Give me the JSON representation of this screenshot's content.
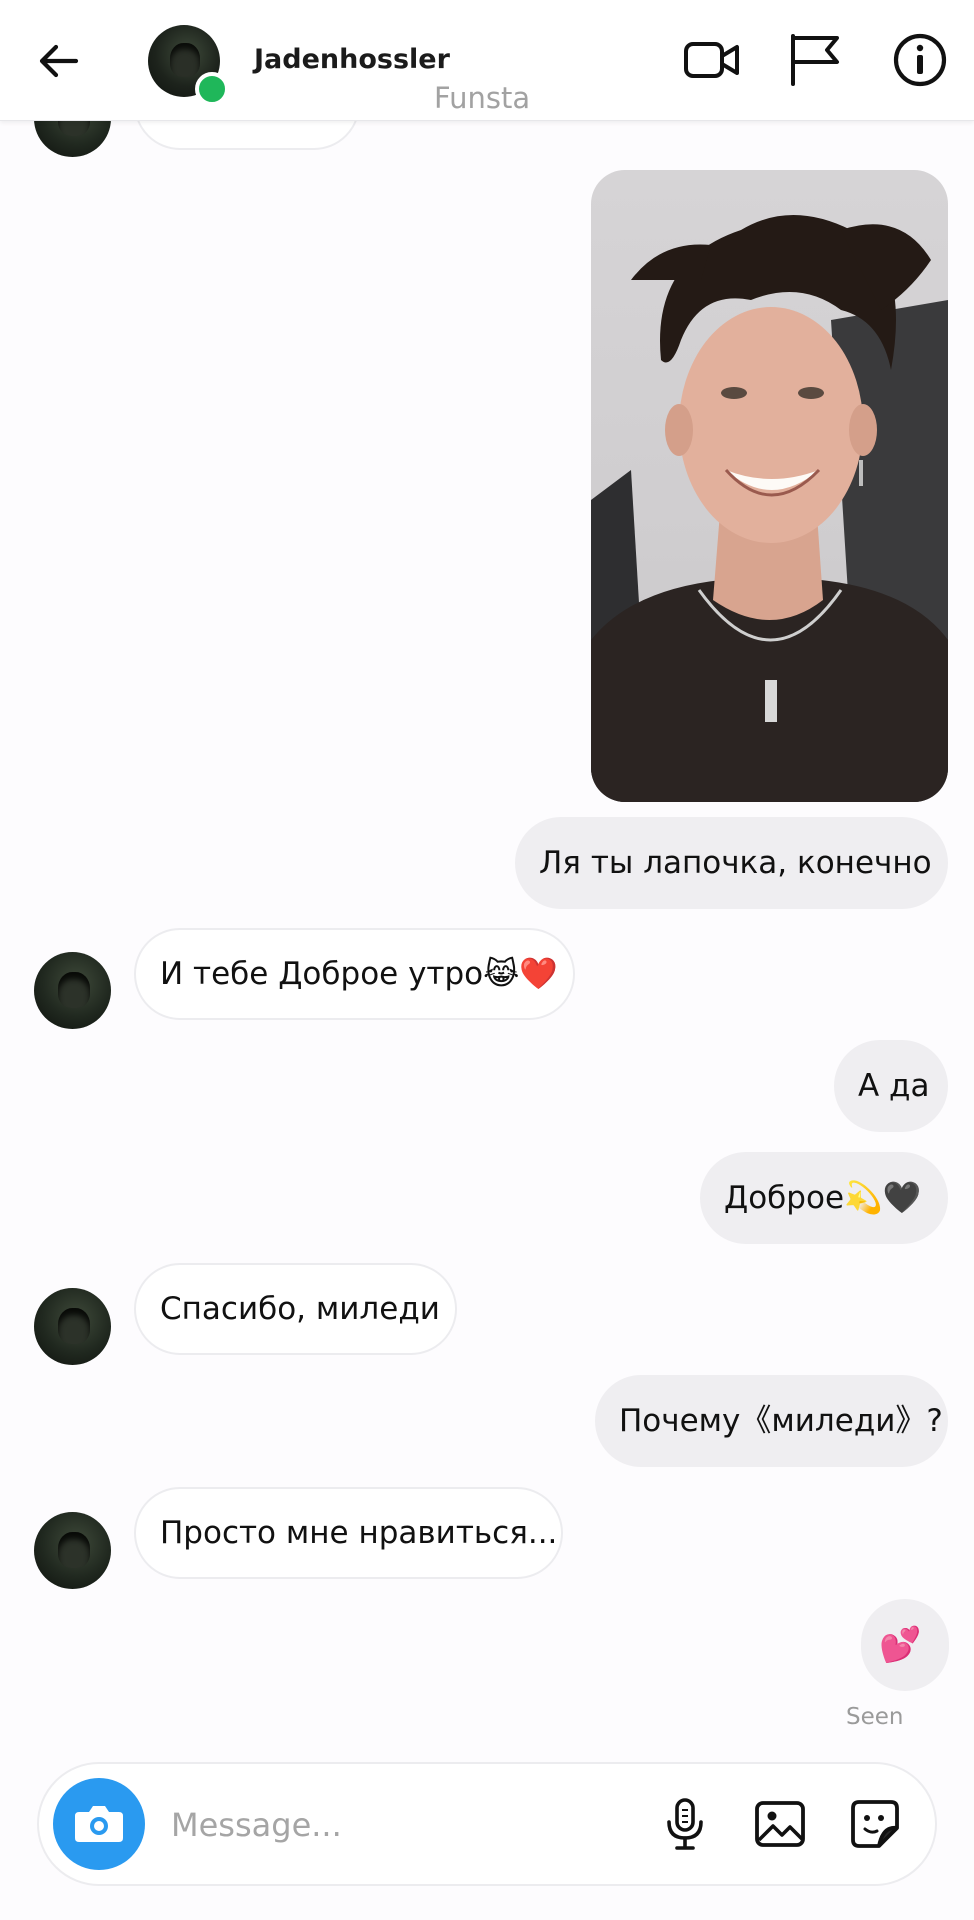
{
  "header": {
    "username": "Jadenhossler",
    "subtitle": "Funsta",
    "back_icon": "arrow-left-icon",
    "video_icon": "video-camera-icon",
    "flag_icon": "flag-icon",
    "info_icon": "info-icon",
    "online_color": "#1fb75a"
  },
  "messages": [
    {
      "direction": "outgoing",
      "type": "image",
      "description": "photo"
    },
    {
      "direction": "outgoing",
      "text": "Ля ты лапочка, конечно"
    },
    {
      "direction": "incoming",
      "text": "И тебе Доброе утро😹❤️"
    },
    {
      "direction": "outgoing",
      "text": "А да"
    },
    {
      "direction": "outgoing",
      "text": "Доброе💫🖤"
    },
    {
      "direction": "incoming",
      "text": "Спасибо, миледи"
    },
    {
      "direction": "outgoing",
      "text": "Почему《миледи》?"
    },
    {
      "direction": "incoming",
      "text": "Просто мне нравиться..."
    },
    {
      "direction": "outgoing",
      "text": "💕"
    }
  ],
  "status": {
    "seen": "Seen"
  },
  "composer": {
    "placeholder": "Message...",
    "camera_icon": "camera-icon",
    "mic_icon": "microphone-icon",
    "gallery_icon": "image-gallery-icon",
    "sticker_icon": "sticker-icon",
    "camera_color": "#2a9af0"
  }
}
